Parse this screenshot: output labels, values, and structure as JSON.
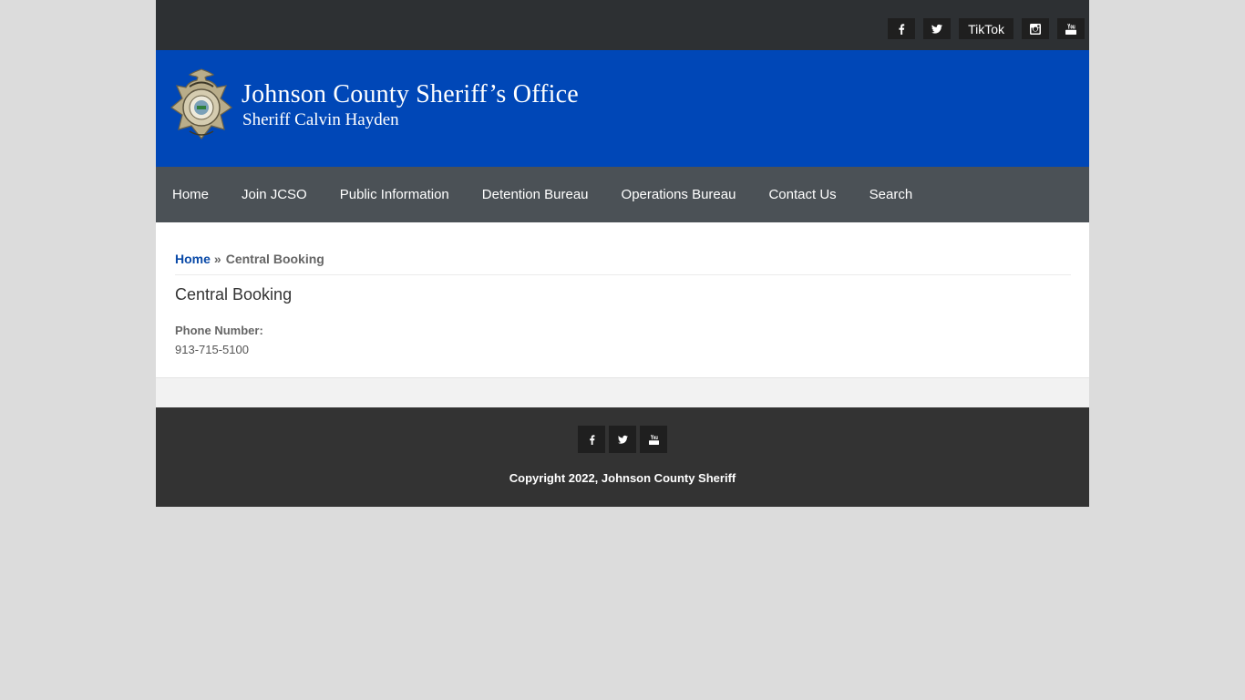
{
  "top_social": {
    "facebook_icon": "facebook-icon",
    "twitter_icon": "twitter-icon",
    "tiktok_label": "TikTok",
    "instagram_icon": "instagram-icon",
    "youtube_icon": "youtube-icon"
  },
  "header": {
    "title": "Johnson County Sheriff’s Office",
    "subtitle": "Sheriff Calvin Hayden",
    "badge_icon": "sheriff-badge-logo"
  },
  "nav": {
    "items": [
      {
        "label": "Home"
      },
      {
        "label": "Join JCSO"
      },
      {
        "label": "Public Information"
      },
      {
        "label": "Detention Bureau"
      },
      {
        "label": "Operations Bureau"
      },
      {
        "label": "Contact Us"
      },
      {
        "label": "Search"
      }
    ]
  },
  "breadcrumb": {
    "home": "Home",
    "separator": "»",
    "current": "Central Booking"
  },
  "main": {
    "title": "Central Booking",
    "phone_label": "Phone Number:",
    "phone_value": "913-715-5100"
  },
  "footer": {
    "copyright": "Copyright 2022, Johnson County Sheriff"
  },
  "colors": {
    "header_blue": "#0047b7",
    "topbar": "#2d3033",
    "nav": "#4b5156",
    "footer": "#333333",
    "link": "#0a4aa8"
  }
}
